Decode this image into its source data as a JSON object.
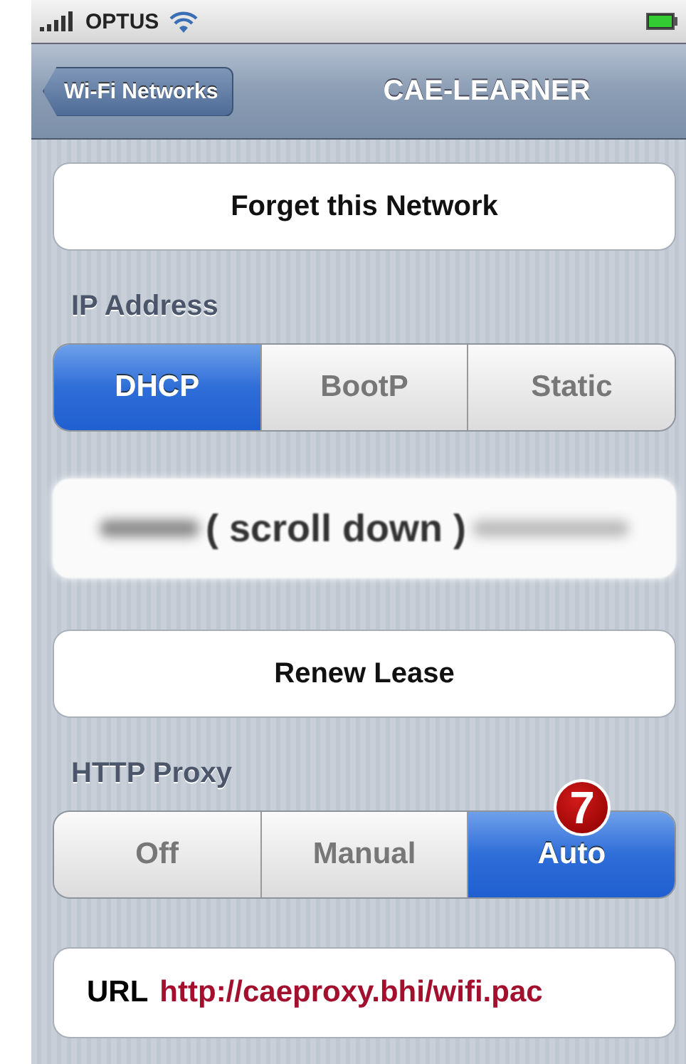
{
  "status_bar": {
    "carrier": "OPTUS"
  },
  "nav_bar": {
    "back_button": "Wi-Fi Networks",
    "title": "CAE-LEARNER"
  },
  "forget_button": "Forget this Network",
  "ip_address": {
    "label": "IP Address",
    "segments": [
      {
        "label": "DHCP",
        "selected": true
      },
      {
        "label": "BootP",
        "selected": false
      },
      {
        "label": "Static",
        "selected": false
      }
    ]
  },
  "blurred_field": {
    "text": "( scroll down )"
  },
  "renew_button": "Renew Lease",
  "http_proxy": {
    "label": "HTTP Proxy",
    "segments": [
      {
        "label": "Off",
        "selected": false
      },
      {
        "label": "Manual",
        "selected": false
      },
      {
        "label": "Auto",
        "selected": true
      }
    ],
    "step_badge": "7"
  },
  "url_field": {
    "label": "URL",
    "value": "http://caeproxy.bhi/wifi.pac"
  }
}
